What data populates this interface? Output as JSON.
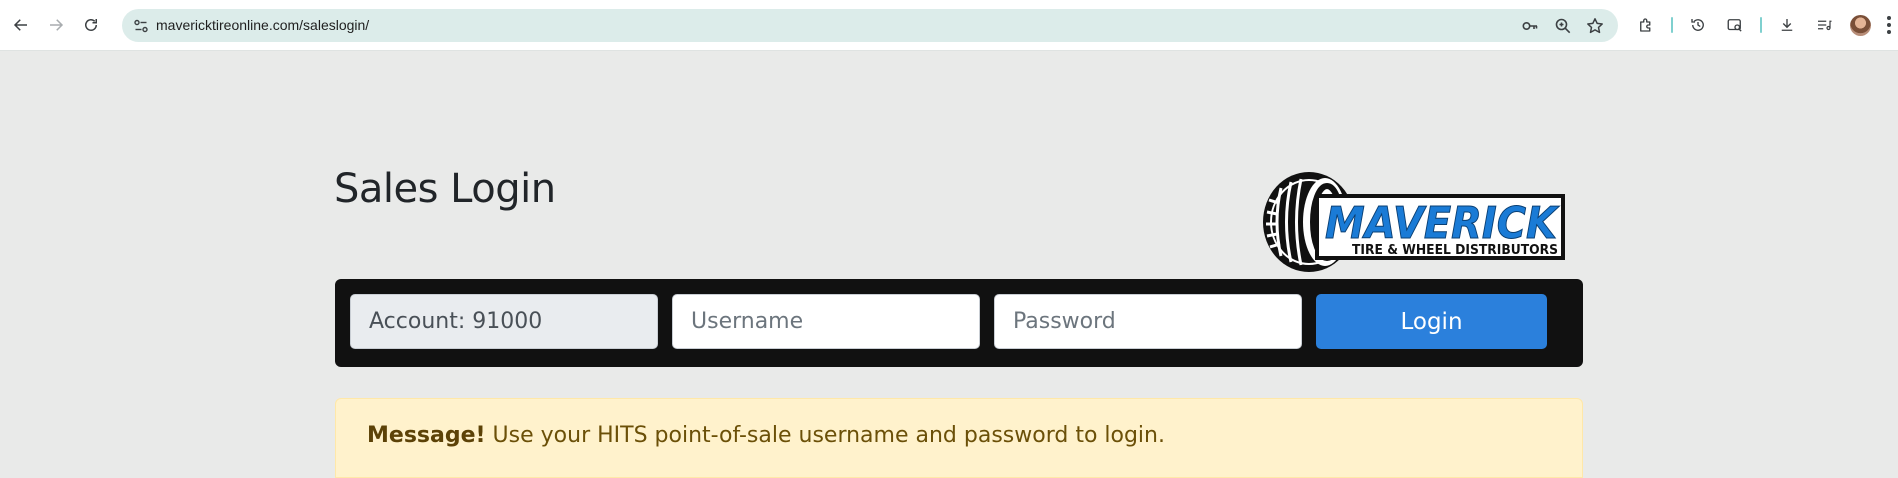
{
  "browser": {
    "url": "mavericktireonline.com/saleslogin/"
  },
  "page": {
    "title": "Sales Login"
  },
  "logo": {
    "brand": "MAVERICK",
    "tagline": "TIRE & WHEEL DISTRIBUTORS",
    "brand_color": "#1a7bd6"
  },
  "login_form": {
    "account_value": "Account: 91000",
    "username_placeholder": "Username",
    "password_placeholder": "Password",
    "login_label": "Login",
    "button_color": "#2b80dc"
  },
  "alert": {
    "label": "Message!",
    "text": " Use your HITS point-of-sale username and password to login."
  }
}
